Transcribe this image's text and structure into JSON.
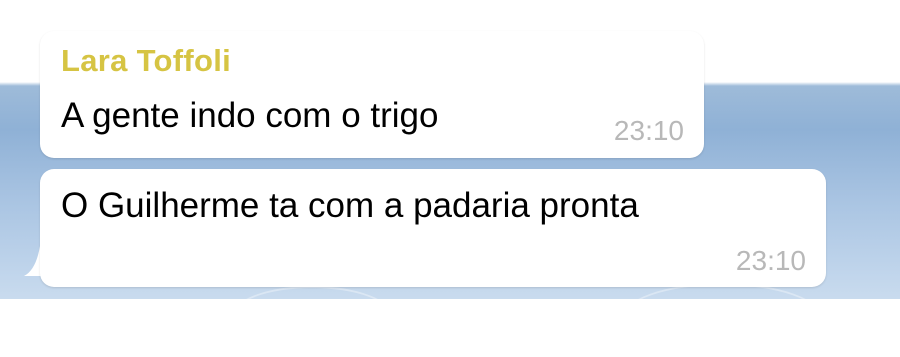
{
  "messages": [
    {
      "sender": "Lara Toffoli",
      "text": "A gente indo com o trigo",
      "time": "23:10"
    },
    {
      "text": "O Guilherme ta com a padaria pronta",
      "time": "23:10"
    }
  ],
  "colors": {
    "sender_name": "#d6c443",
    "bubble": "#ffffff",
    "timestamp": "#b8b8b8",
    "chat_background": "#8fb1d6"
  }
}
